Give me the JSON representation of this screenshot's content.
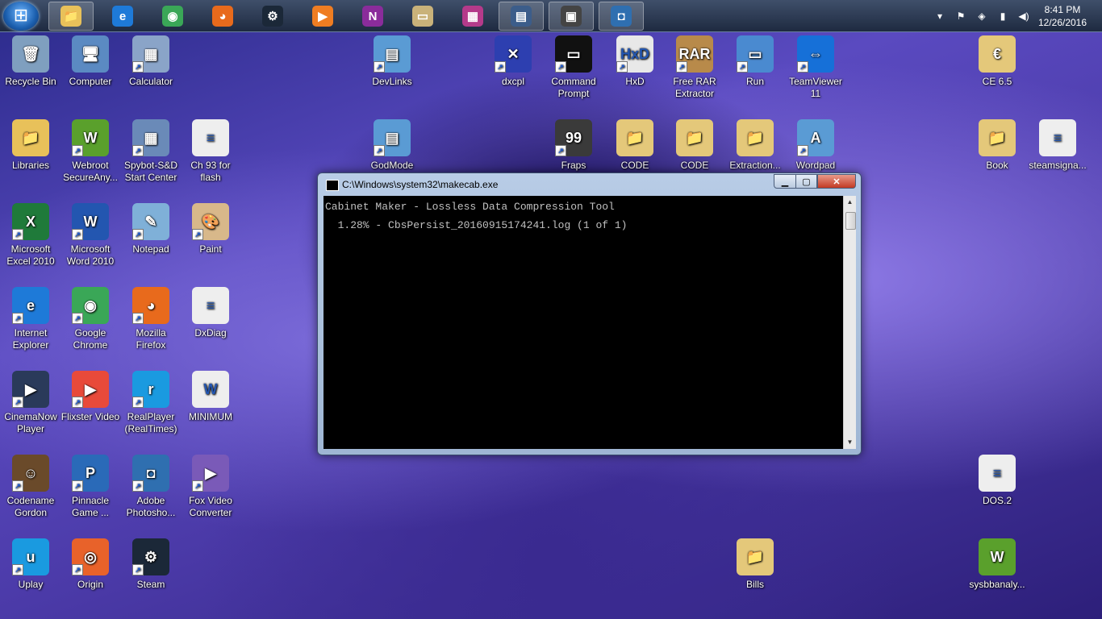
{
  "taskbar": {
    "pinned": [
      {
        "name": "explorer-taskbar-button",
        "glyph": "📁",
        "color": "#e8c15a"
      },
      {
        "name": "ie-taskbar-button",
        "glyph": "e",
        "color": "#1e7ad8"
      },
      {
        "name": "chrome-taskbar-button",
        "glyph": "◉",
        "color": "#3aa757"
      },
      {
        "name": "firefox-taskbar-button",
        "glyph": "◕",
        "color": "#e86a1c"
      },
      {
        "name": "steam-taskbar-button",
        "glyph": "⚙",
        "color": "#1b2838"
      },
      {
        "name": "player-taskbar-button",
        "glyph": "▶",
        "color": "#ef7d22"
      },
      {
        "name": "onenote-taskbar-button",
        "glyph": "N",
        "color": "#8a2c9b"
      },
      {
        "name": "scanner-taskbar-button",
        "glyph": "▭",
        "color": "#c9b27a"
      },
      {
        "name": "winrar-taskbar-button",
        "glyph": "▦",
        "color": "#b53a8a"
      },
      {
        "name": "window-taskbar-button",
        "glyph": "▤",
        "color": "#3c5d8a"
      },
      {
        "name": "console-taskbar-button",
        "glyph": "▣",
        "color": "#444444"
      },
      {
        "name": "camera-taskbar-button",
        "glyph": "◘",
        "color": "#2f6fb0"
      }
    ],
    "clock_time": "8:41 PM",
    "clock_date": "12/26/2016"
  },
  "desktop": {
    "icons": [
      {
        "label": "Recycle Bin",
        "name": "recycle-bin-icon",
        "glyph": "🗑",
        "color": "#7f9fbf"
      },
      {
        "label": "Computer",
        "name": "computer-icon",
        "glyph": "🖥",
        "color": "#5b8ac2"
      },
      {
        "label": "Calculator",
        "name": "calculator-icon",
        "glyph": "▦",
        "color": "#8aa4c8"
      },
      {
        "label": "DevLinks",
        "name": "devlinks-icon",
        "glyph": "▤",
        "color": "#5a9bd4"
      },
      {
        "label": "dxcpl",
        "name": "dxcpl-icon",
        "glyph": "✕",
        "color": "#2d3fb0"
      },
      {
        "label": "Command Prompt",
        "name": "command-prompt-icon",
        "glyph": "▭",
        "color": "#111111"
      },
      {
        "label": "HxD",
        "name": "hxd-icon",
        "glyph": "HxD",
        "color": "#e8e8e8"
      },
      {
        "label": "Free RAR Extractor",
        "name": "free-rar-extractor-icon",
        "glyph": "RAR",
        "color": "#b88a4a"
      },
      {
        "label": "Run",
        "name": "run-icon",
        "glyph": "▭",
        "color": "#4a8ad0"
      },
      {
        "label": "TeamViewer 11",
        "name": "teamviewer-icon",
        "glyph": "⇔",
        "color": "#1670d8"
      },
      {
        "label": "CE 6.5",
        "name": "ce-icon",
        "glyph": "€",
        "color": "#e4c87a"
      },
      {
        "label": "Libraries",
        "name": "libraries-icon",
        "glyph": "📁",
        "color": "#e8c15a"
      },
      {
        "label": "Webroot SecureAny...",
        "name": "webroot-icon",
        "glyph": "W",
        "color": "#5aa02c"
      },
      {
        "label": "Spybot-S&D Start Center",
        "name": "spybot-icon",
        "glyph": "▦",
        "color": "#6a8ab8"
      },
      {
        "label": "Ch 93 for flash",
        "name": "ch93-file-icon",
        "glyph": "≡",
        "color": "#eeeeee"
      },
      {
        "label": "GodMode",
        "name": "godmode-icon",
        "glyph": "▤",
        "color": "#5a9bd4"
      },
      {
        "label": "Fraps",
        "name": "fraps-icon",
        "glyph": "99",
        "color": "#3a3a3a"
      },
      {
        "label": "CODE",
        "name": "code-folder-1-icon",
        "glyph": "📁",
        "color": "#e4c87a"
      },
      {
        "label": "CODE",
        "name": "code-folder-2-icon",
        "glyph": "📁",
        "color": "#e4c87a"
      },
      {
        "label": "Extraction...",
        "name": "extraction-folder-icon",
        "glyph": "📁",
        "color": "#e4c87a"
      },
      {
        "label": "Wordpad",
        "name": "wordpad-icon",
        "glyph": "A",
        "color": "#5a9bd4"
      },
      {
        "label": "Book",
        "name": "book-folder-icon",
        "glyph": "📁",
        "color": "#e4c87a"
      },
      {
        "label": "steamsigna...",
        "name": "steamsigna-file-icon",
        "glyph": "≡",
        "color": "#eeeeee"
      },
      {
        "label": "Microsoft Excel 2010",
        "name": "excel-icon",
        "glyph": "X",
        "color": "#1f7a3a"
      },
      {
        "label": "Microsoft Word 2010",
        "name": "word-icon",
        "glyph": "W",
        "color": "#2356b0"
      },
      {
        "label": "Notepad",
        "name": "notepad-icon",
        "glyph": "✎",
        "color": "#7fb0d8"
      },
      {
        "label": "Paint",
        "name": "paint-icon",
        "glyph": "🎨",
        "color": "#d8b88a"
      },
      {
        "label": "Internet Explorer",
        "name": "internet-explorer-icon",
        "glyph": "e",
        "color": "#1e7ad8"
      },
      {
        "label": "Google Chrome",
        "name": "google-chrome-icon",
        "glyph": "◉",
        "color": "#3aa757"
      },
      {
        "label": "Mozilla Firefox",
        "name": "firefox-icon",
        "glyph": "◕",
        "color": "#e86a1c"
      },
      {
        "label": "DxDiag",
        "name": "dxdiag-file-icon",
        "glyph": "≡",
        "color": "#eeeeee"
      },
      {
        "label": "CinemaNow Player",
        "name": "cinemanow-icon",
        "glyph": "▶",
        "color": "#2a3a5a"
      },
      {
        "label": "Flixster Video",
        "name": "flixster-icon",
        "glyph": "▶",
        "color": "#e84a3a"
      },
      {
        "label": "RealPlayer (RealTimes)",
        "name": "realplayer-icon",
        "glyph": "r",
        "color": "#1a9ae0"
      },
      {
        "label": "MINIMUM",
        "name": "minimum-doc-icon",
        "glyph": "W",
        "color": "#eeeeee"
      },
      {
        "label": "DOS.2",
        "name": "dos2-file-icon",
        "glyph": "≡",
        "color": "#eeeeee"
      },
      {
        "label": "Codename Gordon",
        "name": "codename-gordon-icon",
        "glyph": "☺",
        "color": "#6a4a2a"
      },
      {
        "label": "Pinnacle Game ...",
        "name": "pinnacle-icon",
        "glyph": "P",
        "color": "#2a6ab8"
      },
      {
        "label": "Adobe Photosho...",
        "name": "photoshop-icon",
        "glyph": "◘",
        "color": "#2f6fb0"
      },
      {
        "label": "Fox Video Converter",
        "name": "fox-video-converter-icon",
        "glyph": "▶",
        "color": "#7a5ab8"
      },
      {
        "label": "Uplay",
        "name": "uplay-icon",
        "glyph": "u",
        "color": "#1a9ae0"
      },
      {
        "label": "Origin",
        "name": "origin-icon",
        "glyph": "◎",
        "color": "#e8622a"
      },
      {
        "label": "Steam",
        "name": "steam-icon",
        "glyph": "⚙",
        "color": "#1b2838"
      },
      {
        "label": "Bills",
        "name": "bills-folder-icon",
        "glyph": "📁",
        "color": "#e4c87a"
      },
      {
        "label": "sysbbanaly...",
        "name": "sysbbanaly-icon",
        "glyph": "W",
        "color": "#5aa02c"
      }
    ]
  },
  "window": {
    "title": "C:\\Windows\\system32\\makecab.exe",
    "console_lines": [
      "Cabinet Maker - Lossless Data Compression Tool",
      "  1.28% - CbsPersist_20160915174241.log (1 of 1)"
    ]
  }
}
